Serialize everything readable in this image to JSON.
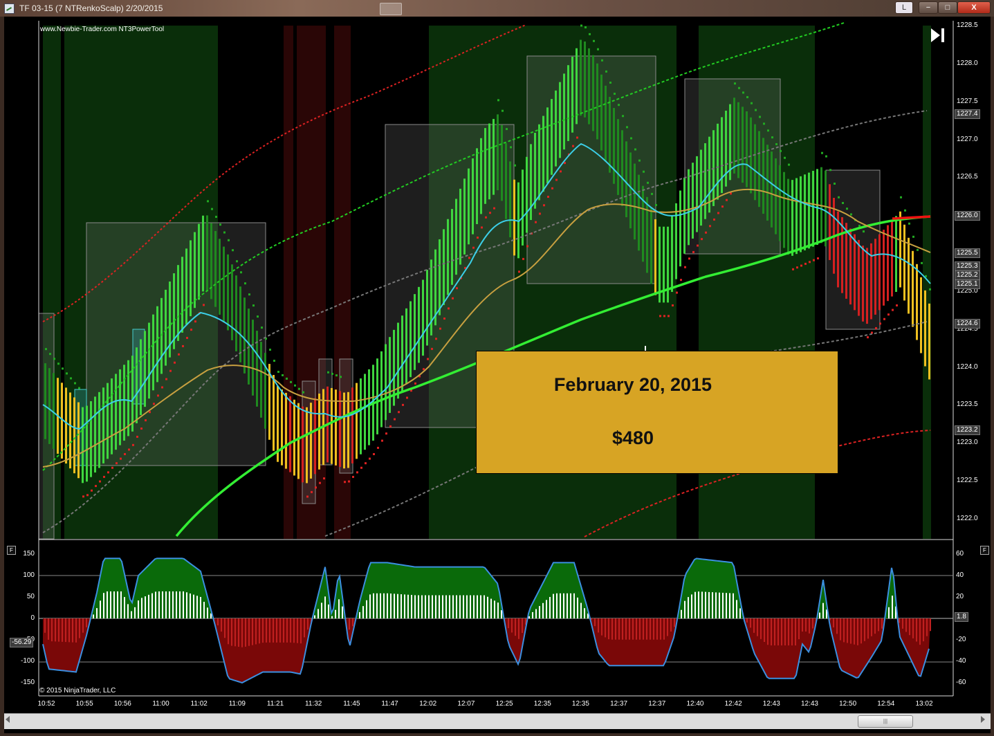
{
  "window": {
    "title": "TF 03-15 (7 NTRenkoScalp)  2/20/2015",
    "layout_button_label": "L",
    "minimize_label": "−",
    "maximize_label": "□",
    "close_label": "X"
  },
  "chart": {
    "watermark": "www.Newbie-Trader.com NT3PowerTool",
    "copyright": "© 2015 NinjaTrader, LLC",
    "price_axis_labels": [
      "1228.5",
      "1228.0",
      "1227.5",
      "1227.0",
      "1226.5",
      "1226.0",
      "1225.5",
      "1225.0",
      "1224.5",
      "1224.0",
      "1223.5",
      "1223.0",
      "1222.5",
      "1222.0"
    ],
    "price_tags": [
      "1227.4",
      "1226.0",
      "1225.5",
      "1225.3",
      "1225.2",
      "1225.1",
      "1224.6",
      "1223.2"
    ],
    "indicator_left_labels": [
      "150",
      "100",
      "50",
      "0",
      "-50",
      "-100",
      "-150"
    ],
    "indicator_right_labels": [
      "60",
      "40",
      "20",
      "-20",
      "-40",
      "-60"
    ],
    "indicator_left_tag": "-56.29",
    "indicator_right_tag": "1.8",
    "panel_icon_label": "F",
    "time_labels": [
      "10:52",
      "10:55",
      "10:56",
      "11:00",
      "11:02",
      "11:09",
      "11:21",
      "11:32",
      "11:45",
      "11:47",
      "12:02",
      "12:07",
      "12:25",
      "12:35",
      "12:35",
      "12:37",
      "12:37",
      "12:40",
      "12:42",
      "12:43",
      "12:43",
      "12:50",
      "12:54",
      "13:02"
    ],
    "scroll_thumb_label": "|||"
  },
  "banner": {
    "date": "February 20, 2015",
    "amount": "$480"
  },
  "colors": {
    "bull_bar": "#3fd63f",
    "bull_bar_dark": "#1f8a1f",
    "bear_bar": "#d42020",
    "neutral_bar": "#f0c020",
    "ema_cyan": "#3ccfe8",
    "ema_tan": "#c8a040",
    "sma_green": "#22ee22",
    "background": "#000000",
    "banner_bg": "#d7a424",
    "zone_bull": "#0e3a0e",
    "zone_bear": "#3a0a0a"
  }
}
